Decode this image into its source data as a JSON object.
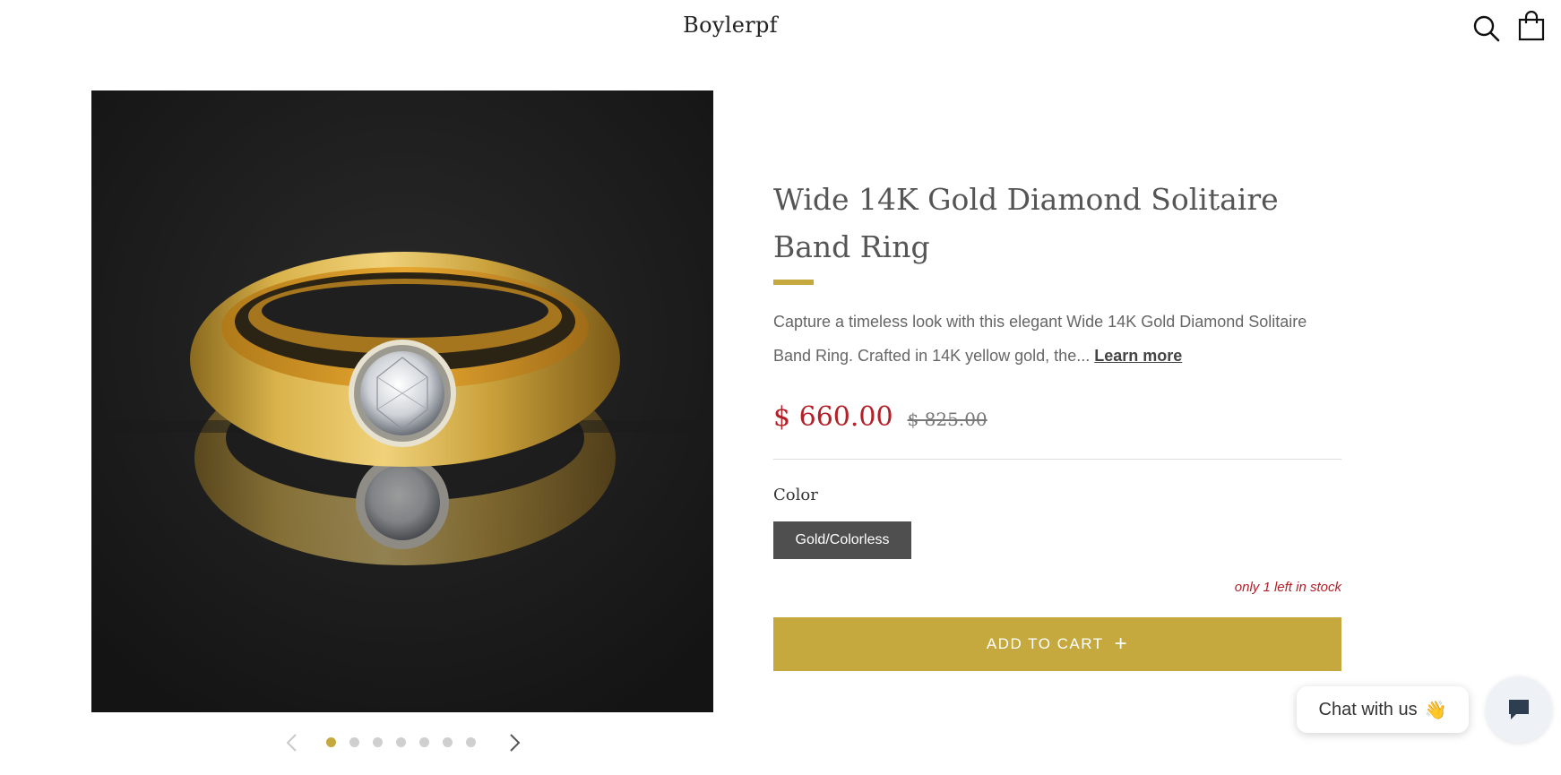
{
  "header": {
    "logo": "Boylerpf",
    "icons": [
      "search-icon",
      "cart-icon"
    ]
  },
  "gallery": {
    "image_description_icon": "ring-photo",
    "slide_count": 7,
    "active_slide": 1
  },
  "product": {
    "title": "Wide 14K Gold Diamond Solitaire Band Ring",
    "description": "Capture a timeless look with this elegant Wide 14K Gold Diamond Solitaire Band Ring. Crafted in 14K yellow gold, the...",
    "learn_more": "Learn more",
    "sale_price": "$ 660.00",
    "compare_price": "$ 825.00",
    "option_label": "Color",
    "color_option": "Gold/Colorless",
    "stock_note": "only 1 left in stock",
    "add_to_cart": "ADD TO CART",
    "plus_glyph": "+"
  },
  "chat": {
    "label": "Chat with us",
    "wave_glyph": "👋"
  },
  "colors": {
    "accent_gold": "#c5a93e",
    "sale_red": "#b32028",
    "swatch_dark": "#4f4f4f"
  }
}
